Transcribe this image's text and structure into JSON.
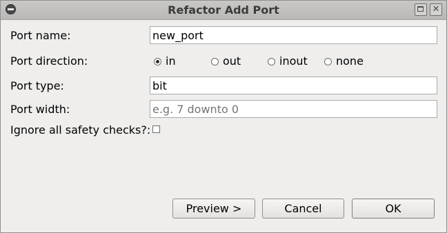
{
  "window": {
    "title": "Refactor Add Port",
    "menu_icon": "window-menu-icon",
    "maximize_icon": "maximize-icon",
    "close_icon": "close-icon",
    "close_glyph": "✕"
  },
  "form": {
    "port_name_label": "Port name:",
    "port_name_value": "new_port",
    "port_direction_label": "Port direction:",
    "directions": [
      {
        "label": "in",
        "checked": true
      },
      {
        "label": "out",
        "checked": false
      },
      {
        "label": "inout",
        "checked": false
      },
      {
        "label": "none",
        "checked": false
      }
    ],
    "port_type_label": "Port type:",
    "port_type_value": "bit",
    "port_width_label": "Port width:",
    "port_width_value": "",
    "port_width_placeholder": "e.g. 7 downto 0",
    "ignore_checks_label": "Ignore all safety checks?:",
    "ignore_checks_checked": false
  },
  "buttons": {
    "preview": "Preview >",
    "cancel": "Cancel",
    "ok": "OK"
  }
}
